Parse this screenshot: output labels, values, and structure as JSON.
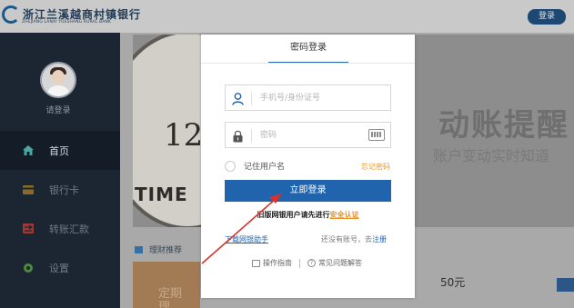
{
  "header": {
    "logo_cn": "浙江兰溪越商村镇银行",
    "logo_en": "ZHEJIANG LANXI YUESHANG RURAL BANK",
    "login_button": "登录"
  },
  "sidebar": {
    "user_label": "请登录",
    "items": [
      {
        "label": "首页",
        "icon": "home-icon"
      },
      {
        "label": "银行卡",
        "icon": "card-icon"
      },
      {
        "label": "转账汇款",
        "icon": "transfer-icon"
      },
      {
        "label": "设置",
        "icon": "gear-icon"
      }
    ]
  },
  "banner": {
    "clock_number": "12",
    "clock_brand": "TIME",
    "promo_title": "动账提醒",
    "promo_subtitle": "账户变动实时知道"
  },
  "recommend": {
    "title": "理财推荐",
    "card_text": "定期\n理",
    "price": "50元"
  },
  "login_modal": {
    "tab": "密码登录",
    "username_placeholder": "手机号/身份证号",
    "password_placeholder": "密码",
    "remember_label": "记住用户名",
    "forgot_label": "忘记密码",
    "login_button": "立即登录",
    "old_user_text": "旧版网银用户请先进行",
    "security_link": "安全认证",
    "download_link": "下载网银助手",
    "no_account_text": "还没有账号，去",
    "register_link": "注册",
    "guide_link": "操作指南",
    "faq_link": "常见问题解答"
  },
  "colors": {
    "primary": "#1f64ad",
    "sidebar_bg": "#1c2633",
    "link_orange": "#e8912a",
    "arrow_red": "#d9322b"
  }
}
